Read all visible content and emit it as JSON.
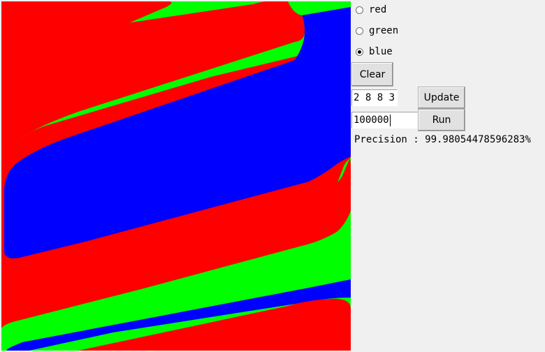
{
  "colors": {
    "red": "#ff0000",
    "green": "#00ff00",
    "blue": "#0000ff",
    "panel_bg": "#f0f0f0"
  },
  "radio_options": [
    {
      "label": "red",
      "checked": false
    },
    {
      "label": "green",
      "checked": false
    },
    {
      "label": "blue",
      "checked": true
    }
  ],
  "controls": {
    "clear_label": "Clear",
    "layers_value": "2 8 8 3",
    "update_label": "Update",
    "iterations_value": "100000",
    "run_label": "Run"
  },
  "status": {
    "precision_text": "Precision : 99.98054478596283%"
  }
}
